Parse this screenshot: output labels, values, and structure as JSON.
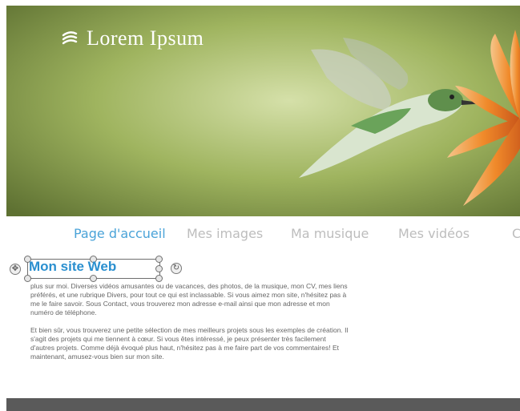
{
  "header": {
    "logo_text": "Lorem Ipsum"
  },
  "nav": {
    "items": [
      {
        "label": "Page d'accueil",
        "active": true
      },
      {
        "label": "Mes images",
        "active": false
      },
      {
        "label": "Ma musique",
        "active": false
      },
      {
        "label": "Mes vidéos",
        "active": false
      },
      {
        "label": "C",
        "active": false
      }
    ]
  },
  "editor": {
    "selected_text": "Mon site Web"
  },
  "content": {
    "paragraph1": "plus sur moi. Diverses vidéos amusantes ou de vacances, des photos, de la musique, mon CV, mes liens préférés, et une rubrique Divers, pour tout ce qui est inclassable. Si vous aimez mon site, n'hésitez pas à me le faire savoir. Sous Contact, vous trouverez mon adresse e-mail ainsi que mon adresse et mon numéro de téléphone.",
    "paragraph2": "Et bien sûr, vous trouverez une petite sélection de mes meilleurs projets sous les exemples de création. Il s'agit des projets qui me tiennent à cœur. Si vous êtes intéressé, je peux présenter très facilement d'autres projets. Comme déjà évoqué plus haut, n'hésitez pas à me faire part de vos commentaires! Et maintenant, amusez-vous bien sur mon site."
  },
  "colors": {
    "accent": "#2a8fcf",
    "nav_inactive": "#bdbdbd",
    "footer": "#5a5a5a"
  }
}
